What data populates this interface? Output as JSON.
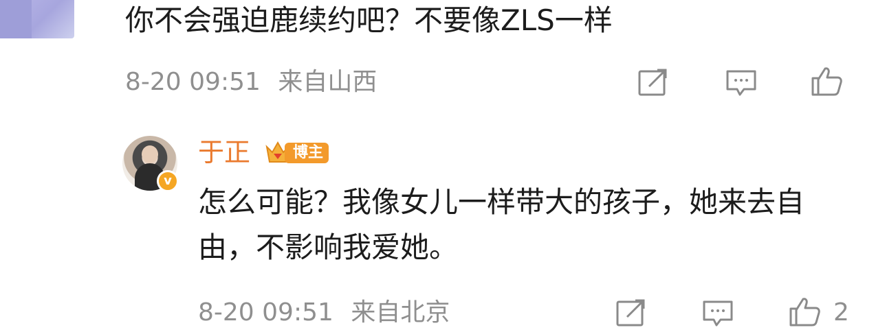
{
  "comment": {
    "text": "你不会强迫鹿续约吧？不要像ZLS一样",
    "time": "8-20 09:51",
    "location": "来自山西",
    "icons": {
      "share": "share-icon",
      "reply": "comment-icon",
      "like": "thumbs-up-icon"
    }
  },
  "reply": {
    "author": "于正",
    "badge_label": "博主",
    "verified_icon": "verified-v-icon",
    "text": "怎么可能？我像女儿一样带大的孩子，她来去自由，不影响我爱她。",
    "time": "8-20 09:51",
    "location": "来自北京",
    "like_count": "2",
    "icons": {
      "share": "share-icon",
      "reply": "comment-icon",
      "like": "thumbs-up-icon"
    }
  },
  "colors": {
    "author_name": "#ea7a2e",
    "badge_orange": "#f39a2b",
    "meta_gray": "#8f8f8f",
    "text": "#1c1c1c"
  }
}
